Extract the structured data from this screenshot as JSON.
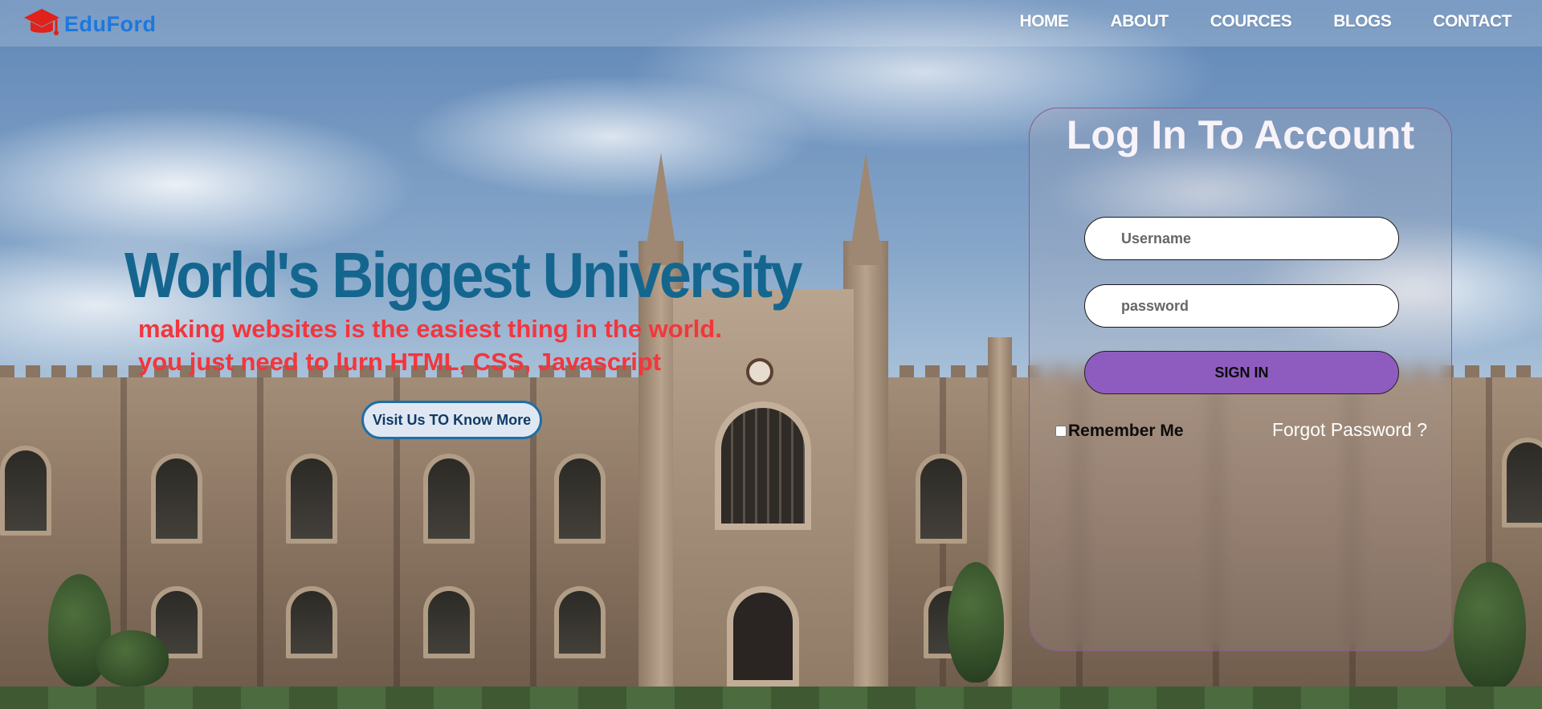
{
  "brand": {
    "name": "EduFord",
    "logo_icon": "graduation-cap-icon",
    "color": "#1b78de"
  },
  "nav": {
    "items": [
      "HOME",
      "ABOUT",
      "COURCES",
      "BLOGS",
      "CONTACT"
    ]
  },
  "hero": {
    "title": "World's Biggest University",
    "subtitle_line1": "making websites is the easiest thing in the world.",
    "subtitle_line2": "you just need to lurn HTML, CSS, Javascript",
    "button_label": "Visit Us TO Know More",
    "title_color": "#14668f",
    "subtitle_color": "#f2363d"
  },
  "login": {
    "title": "Log In To Account",
    "username_placeholder": "Username",
    "password_placeholder": "password",
    "signin_label": "SIGN IN",
    "remember_label": "Remember Me",
    "remember_checked": false,
    "forgot_label": "Forgot Password ?",
    "signin_color": "#8e5cbf"
  }
}
